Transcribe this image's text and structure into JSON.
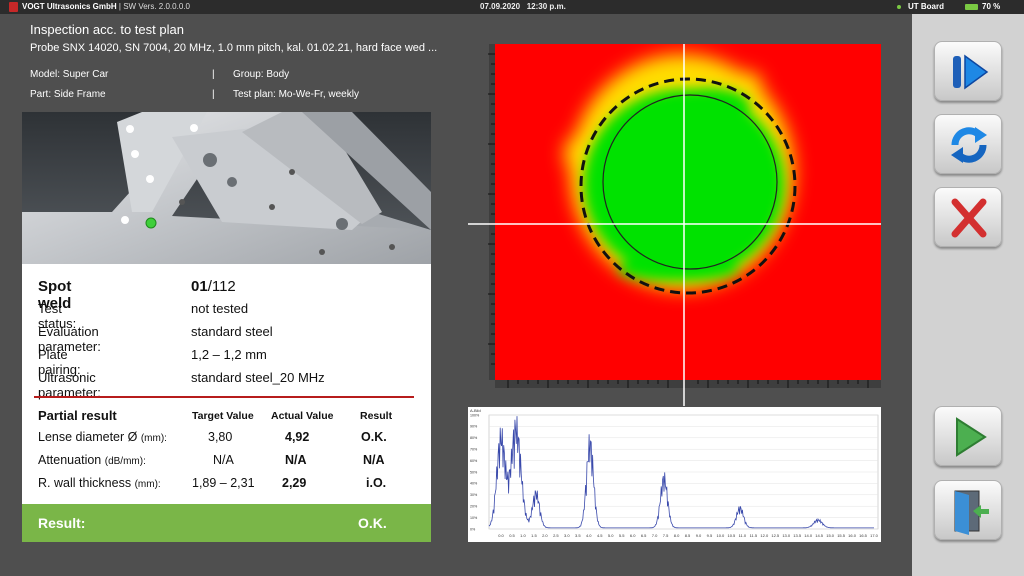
{
  "topbar": {
    "company": "VOGT Ultrasonics GmbH",
    "sw_label": "| SW Vers.",
    "sw_version": "2.0.0.0.0",
    "date": "07.09.2020",
    "time": "12:30 p.m.",
    "board": "UT Board",
    "battery": "70 %"
  },
  "header": {
    "title": "Inspection acc. to test plan",
    "probe": "Probe SNX 14020, SN 7004, 20 MHz, 1.0 mm pitch, kal. 01.02.21, hard face wed ...",
    "model": "Model: Super Car",
    "group": "Group: Body",
    "part": "Part: Side Frame",
    "test_plan": "Test plan: Mo-We-Fr, weekly",
    "separator": "|"
  },
  "spot": {
    "label": "Spot weld",
    "current": "01",
    "total": "/112",
    "rows": [
      {
        "key": "Test status:",
        "value": "not tested"
      },
      {
        "key": "Evaluation parameter:",
        "value": "standard steel"
      },
      {
        "key": "Plate pairing:",
        "value": "1,2 – 1,2 mm"
      },
      {
        "key": "Ultrasonic parameter:",
        "value": "standard steel_20 MHz"
      }
    ]
  },
  "partial": {
    "title": "Partial result",
    "headers": [
      "Target Value",
      "Actual Value",
      "Result"
    ],
    "rows": [
      {
        "name": "Lense diameter Ø",
        "unit": "(mm):",
        "target": "3,80",
        "actual": "4,92",
        "result": "O.K."
      },
      {
        "name": "Attenuation",
        "unit": "(dB/mm):",
        "target": "N/A",
        "actual": "N/A",
        "result": "N/A"
      },
      {
        "name": "R. wall thickness",
        "unit": "(mm):",
        "target": "1,89 – 2,31",
        "actual": "2,29",
        "result": "i.O."
      }
    ]
  },
  "result": {
    "label": "Result:",
    "value": "O.K."
  },
  "ascan": {
    "title": "A-Bild",
    "y_ticks": [
      "100%",
      "90%",
      "80%",
      "70%",
      "60%",
      "50%",
      "40%",
      "30%",
      "20%",
      "10%",
      "0%"
    ],
    "x_ticks": [
      "0.0",
      "0.5",
      "1.0",
      "1.5",
      "2.0",
      "2.5",
      "3.0",
      "3.5",
      "4.0",
      "4.5",
      "5.0",
      "5.5",
      "6.0",
      "6.5",
      "7.0",
      "7.5",
      "8.0",
      "8.5",
      "9.0",
      "9.5",
      "10.0",
      "10.5",
      "11.0",
      "11.5",
      "12.0",
      "12.5",
      "13.0",
      "13.5",
      "14.0",
      "14.5",
      "15.0",
      "15.5",
      "16.0",
      "16.5",
      "17.0"
    ]
  },
  "colors": {
    "ok": "#7ab648",
    "fail": "#ff0000",
    "accent": "#1e88e5",
    "redline": "#b71c1c"
  },
  "buttons": [
    {
      "name": "pause-resume-button",
      "icon": "pause-play-icon"
    },
    {
      "name": "refresh-button",
      "icon": "refresh-icon"
    },
    {
      "name": "cancel-button",
      "icon": "close-icon"
    },
    {
      "name": "start-button",
      "icon": "play-icon"
    },
    {
      "name": "exit-button",
      "icon": "exit-door-icon"
    }
  ]
}
